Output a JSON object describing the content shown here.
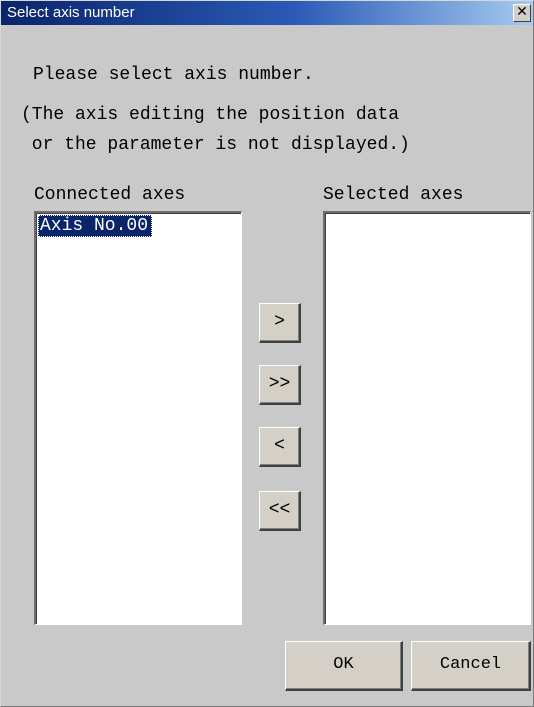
{
  "window": {
    "title": "Select axis number",
    "close_glyph": "✕"
  },
  "instructions": {
    "line1": "Please select axis number.",
    "line2": "(The axis editing the position data",
    "line3": " or the parameter is not displayed.)"
  },
  "connected": {
    "label": "Connected axes",
    "items": [
      {
        "label": "Axis No.00",
        "selected": true
      }
    ]
  },
  "selected": {
    "label": "Selected axes",
    "items": []
  },
  "transfer_buttons": {
    "add": ">",
    "add_all": ">>",
    "remove": "<",
    "remove_all": "<<"
  },
  "dialog_buttons": {
    "ok": "OK",
    "cancel": "Cancel"
  },
  "colors": {
    "titlebar_start": "#0a246a",
    "titlebar_end": "#a6caf0",
    "dialog_bg": "#c9c9c9",
    "selection_bg": "#0a246a"
  }
}
